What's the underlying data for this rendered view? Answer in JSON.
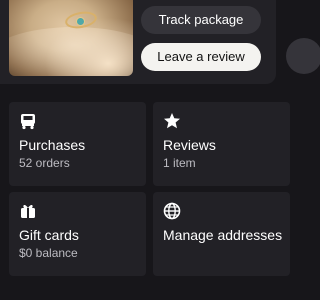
{
  "order": {
    "image_icon": "ring-product-photo",
    "track_label": "Track package",
    "review_label": "Leave a review"
  },
  "tiles": [
    {
      "label": "Purchases",
      "sub": "52 orders",
      "icon": "truck-icon"
    },
    {
      "label": "Reviews",
      "sub": "1 item",
      "icon": "star-icon"
    },
    {
      "label": "Gift cards",
      "sub": "$0 balance",
      "icon": "gift-icon"
    },
    {
      "label": "Manage addresses",
      "sub": "",
      "icon": "globe-icon"
    }
  ],
  "colors": {
    "background": "#17161a",
    "card": "#222126",
    "button_dark": "#35343a",
    "button_light": "#f4f3f0",
    "muted_text": "#bdbcc2"
  }
}
